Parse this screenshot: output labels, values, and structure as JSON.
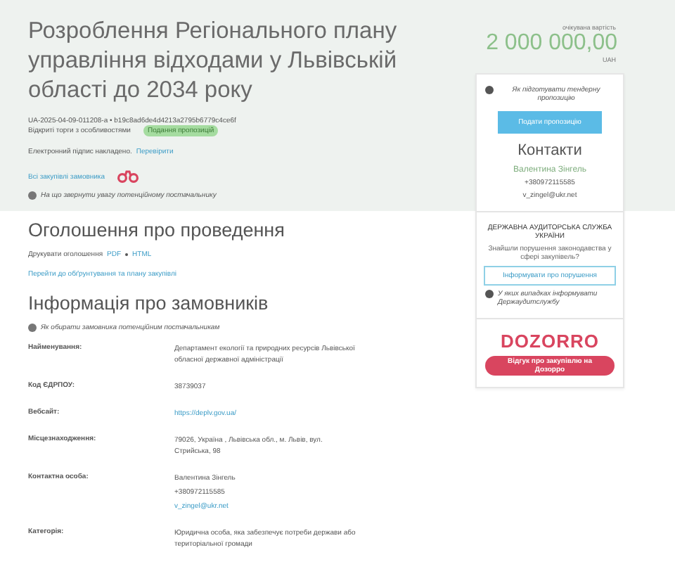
{
  "title": "Розроблення Регіонального плану управління відходами у Львівській області до 2034 року",
  "tender_id": "UA-2025-04-09-011208-a • b19c8ad6de4d4213a2795b6779c4ce6f",
  "procedure": {
    "type": "Відкриті торги з особливостями",
    "status": "Подання пропозицій"
  },
  "signature": {
    "text": "Електронний підпис накладено.",
    "link": "Перевірити"
  },
  "buyer_link": "Всі закупівлі замовника",
  "hint_supplier": "На що звернути увагу потенційному постачальнику",
  "price": {
    "label": "очікувана вартість",
    "amount": "2 000 000,00",
    "currency": "UAH"
  },
  "sidebar": {
    "hint": "Як підготувати тендерну пропозицію",
    "submit_button": "Подати пропозицію",
    "contacts_title": "Контакти",
    "contact_name": "Валентина Зінгель",
    "contact_phone": "+380972115585",
    "contact_email": "v_zingel@ukr.net",
    "audit_title": "ДЕРЖАВНА АУДИТОРСЬКА СЛУЖБА УКРАЇНИ",
    "audit_question": "Знайшли порушення законодавства у сфері закупівель?",
    "audit_button": "Інформувати про порушення",
    "audit_hint": "У яких випадках інформувати Держаудитслужбу",
    "dozorro_logo": "DOZORRO",
    "dozorro_button": "Відгук про закупівлю на Дозорро"
  },
  "announcement": {
    "title": "Оголошення про проведення",
    "print_label": "Друкувати оголошення",
    "print_links": [
      "PDF",
      "HTML"
    ],
    "plan_link": "Перейти до обґрунтування та плану закупівлі"
  },
  "buyer_info": {
    "title": "Інформація про замовників",
    "hint": "Як обирати замовника потенційним постачальникам",
    "rows": [
      {
        "label": "Найменування:",
        "lines": [
          {
            "kind": "text",
            "text": "Департамент екології та природних ресурсів Львівської обласної державної адміністрації"
          }
        ]
      },
      {
        "label": "Код ЄДРПОУ:",
        "lines": [
          {
            "kind": "text",
            "text": "38739037"
          }
        ]
      },
      {
        "label": "Вебсайт:",
        "lines": [
          {
            "kind": "link",
            "text": "https://deplv.gov.ua/"
          }
        ]
      },
      {
        "label": "Місцезнаходження:",
        "lines": [
          {
            "kind": "text",
            "text": "79026, Україна , Львівська обл., м. Львів, вул. Стрийська, 98"
          }
        ]
      },
      {
        "label": "Контактна особа:",
        "lines": [
          {
            "kind": "text",
            "text": "Валентина Зінгель"
          },
          {
            "kind": "text",
            "text": "+380972115585"
          },
          {
            "kind": "link",
            "text": "v_zingel@ukr.net"
          }
        ]
      },
      {
        "label": "Категорія:",
        "lines": [
          {
            "kind": "text",
            "text": "Юридична особа, яка забезпечує потреби держави або територіальної громади"
          }
        ]
      }
    ]
  }
}
